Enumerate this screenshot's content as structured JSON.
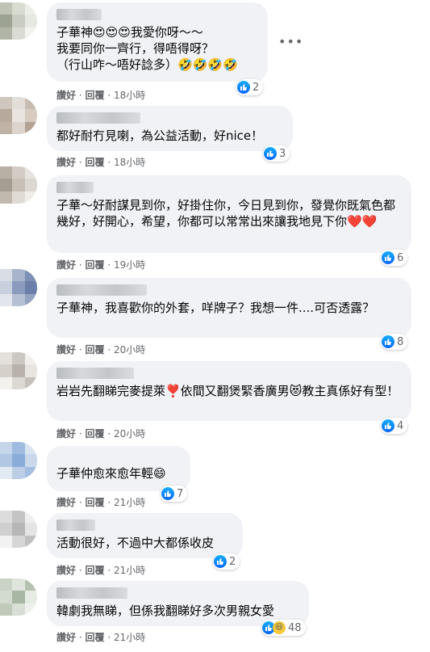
{
  "actions": {
    "like": "讚好",
    "reply": "回覆",
    "sep": "·"
  },
  "comments": [
    {
      "text": "子華神😍😍😍我愛你呀～～\n我要同你一齊行，得唔得呀？\n（行山咋～唔好諗多）🤣🤣🤣🤣",
      "count": "2",
      "time": "18小時"
    },
    {
      "text": "都好耐冇見喇，為公益活動，好nice！",
      "count": "3",
      "time": "18小時"
    },
    {
      "text": "子華～好耐謀見到你，好掛住你，今日見到你，發覺你既氣色都幾好，好開心，希望，你都可以常常出來讓我地見下你❤️❤️",
      "count": "6",
      "time": "19小時"
    },
    {
      "text": "子華神，我喜歡你的外套，咩牌子？我想一件....可否透露？",
      "count": "8",
      "time": "20小時"
    },
    {
      "text": "岩岩先翻睇完麥提萊❣️依間又翻煲緊香廣男😻教主真係好有型！",
      "count": "4",
      "time": "20小時"
    },
    {
      "text": "子華仲愈來愈年輕😄",
      "count": "7",
      "time": "21小時"
    },
    {
      "text": "活動很好，不過中大都係收皮",
      "count": "2",
      "time": "21小時"
    },
    {
      "text": "韓劇我無睇，但係我翻睇好多次男親女愛",
      "count": "48",
      "time": "21小時"
    }
  ],
  "icons": {
    "like": "like-icon",
    "haha": "haha-icon",
    "more": "more-options-icon"
  },
  "colors": {
    "bubble": "#f0f2f5",
    "like_blue": "#0866ff",
    "meta_grey": "#65676b"
  }
}
